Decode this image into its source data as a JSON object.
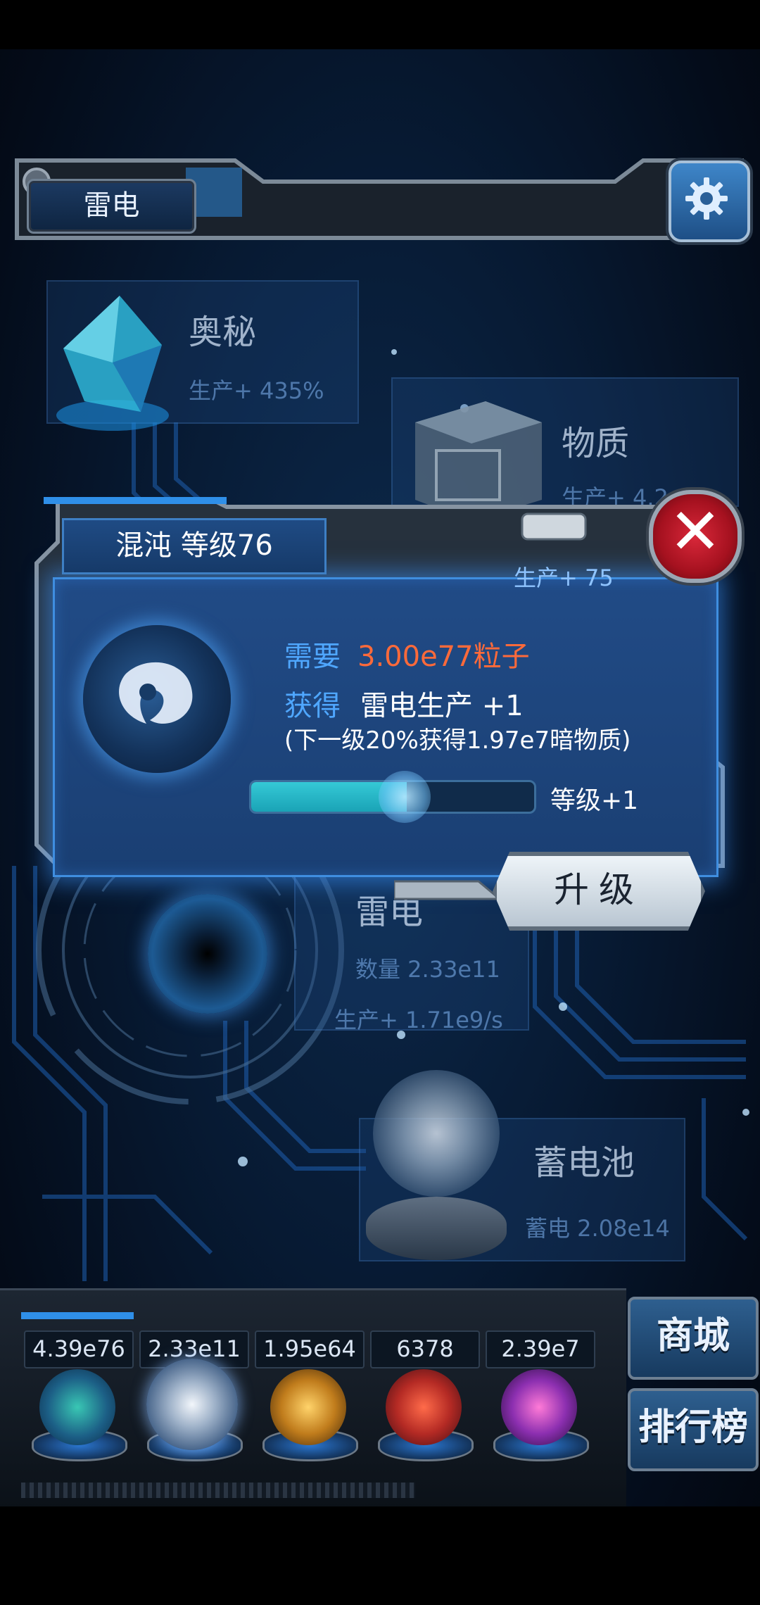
{
  "header": {
    "title": "雷电",
    "settings_icon": "gear-icon"
  },
  "cards": {
    "mystery": {
      "title": "奥秘",
      "sub": "生产+ 435%"
    },
    "matter": {
      "title": "物质",
      "sub": "生产+ 4.2..%"
    },
    "thunder": {
      "title": "雷电",
      "count": "数量 2.33e11",
      "prod": "生产+ 1.71e9/s"
    },
    "battery": {
      "title": "蓄电池",
      "sub": "蓄电 2.08e14"
    }
  },
  "dialog": {
    "title": "混沌 等级76",
    "production": "生产+ 75",
    "require_label": "需要",
    "require_value": "3.00e77粒子",
    "gain_label": "获得",
    "gain_value": "雷电生产 +1",
    "next_level_text": "(下一级20%获得1.97e7暗物质)",
    "level_slider_value": 0.55,
    "level_label": "等级+1",
    "upgrade_label": "升级",
    "close_icon": "close-icon"
  },
  "dock": {
    "items": [
      {
        "count": "4.39e76",
        "icon": "particle-orb-icon"
      },
      {
        "count": "2.33e11",
        "icon": "lightning-orb-icon"
      },
      {
        "count": "1.95e64",
        "icon": "fire-orb-icon"
      },
      {
        "count": "6378",
        "icon": "crystal-orb-icon"
      },
      {
        "count": "2.39e7",
        "icon": "vortex-orb-icon"
      }
    ],
    "shop_label": "商城",
    "ranking_label": "排行榜"
  },
  "colors": {
    "accent_blue": "#4fa7ff",
    "require_orange": "#ff6a3a",
    "slider_fill": "#35c9d6"
  }
}
